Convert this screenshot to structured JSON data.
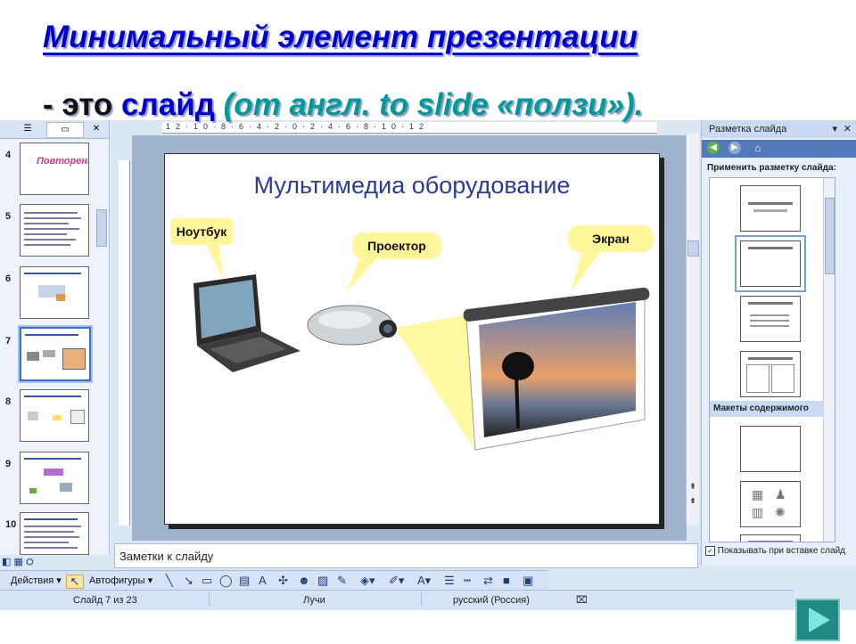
{
  "heading": {
    "line1": "Минимальный элемент презентации ",
    "line2_part1": "- это ",
    "line2_part2": "слайд ",
    "line2_part3": "(от англ. to slide «ползи»)."
  },
  "thumbnail_pane": {
    "slides": [
      {
        "number": "4",
        "mini_title": "Повторение"
      },
      {
        "number": "5"
      },
      {
        "number": "6"
      },
      {
        "number": "7",
        "selected": true
      },
      {
        "number": "8"
      },
      {
        "number": "9"
      },
      {
        "number": "10"
      }
    ]
  },
  "ruler": {
    "top_ticks": "12·10·8·6·4·2·0·2·4·6·8·10·12"
  },
  "slide": {
    "title": "Мультимедиа оборудование",
    "callouts": {
      "laptop": "Ноутбук",
      "projector": "Проектор",
      "screen": "Экран"
    }
  },
  "notes": {
    "placeholder": "Заметки к слайду"
  },
  "task_pane": {
    "title": "Разметка слайда",
    "subtitle": "Применить разметку слайда:",
    "section_content": "Макеты содержимого",
    "show_on_insert": "Показывать при вставке слайд"
  },
  "draw_toolbar": {
    "actions": "Действия",
    "autoshapes": "Автофигуры"
  },
  "status_bar": {
    "slide_counter": "Слайд 7 из 23",
    "design": "Лучи",
    "language": "русский (Россия)"
  },
  "colors": {
    "heading": "#0000cc",
    "accent_teal": "#009999",
    "callout": "#fff79a",
    "nav_button": "#208a84"
  }
}
